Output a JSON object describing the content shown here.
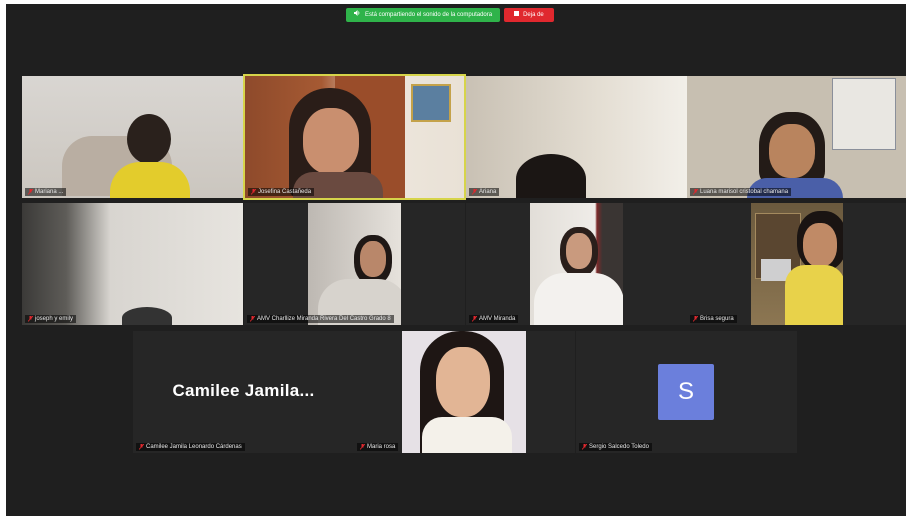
{
  "share_bar": {
    "sharing_text": "Está compartiendo el sonido de la computadora",
    "stop_label": "Deja de"
  },
  "participants": [
    {
      "name": "Mariana ..."
    },
    {
      "name": "Josefina Castañeda"
    },
    {
      "name": "Ariana"
    },
    {
      "name": "Luana marisol cristobal chamana"
    },
    {
      "name": "joseph y emily"
    },
    {
      "name": "AMV Charllize Miranda Rivera Del Castro Grado 8"
    },
    {
      "name": "AMV Miranda"
    },
    {
      "name": "Brisa segura"
    },
    {
      "name": "Camilee Jamila Leonardo Cárdenas",
      "display_name": "Camilee  Jamila..."
    },
    {
      "name": "Maria rosa"
    },
    {
      "name": "Sergio Salcedo Toledo",
      "initial": "S"
    }
  ],
  "colors": {
    "background": "#1f1f1f",
    "tile": "#262626",
    "active_speaker_border": "#d6d44a",
    "share_green": "#2fb34a",
    "stop_red": "#e0282e",
    "avatar_blue": "#6b7fdc",
    "muted_mic_red": "#e0282e"
  },
  "icons": {
    "share": "speaker-icon",
    "stop": "stop-square-icon",
    "mic": "muted-mic-icon"
  }
}
